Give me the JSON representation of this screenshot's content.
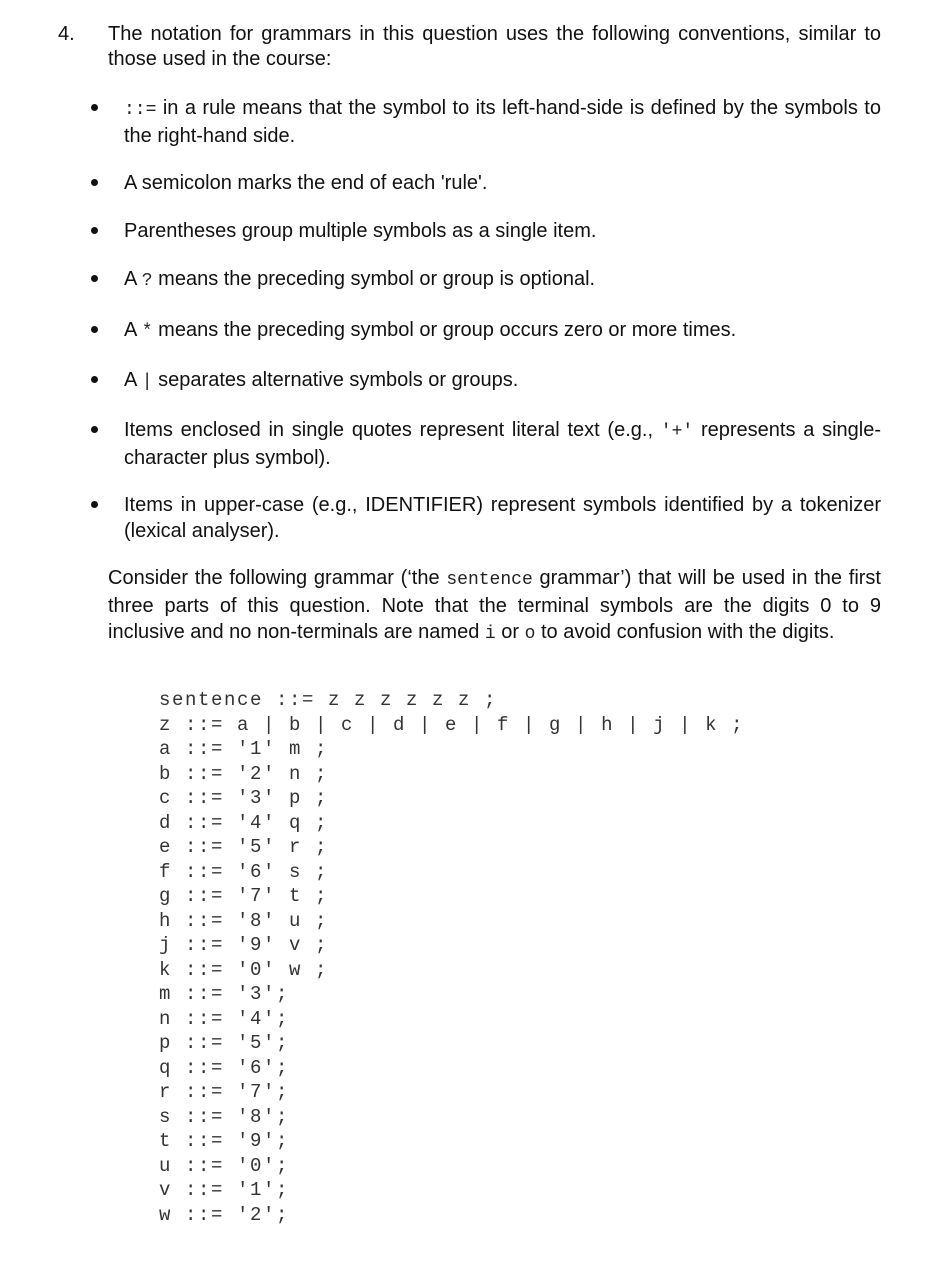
{
  "question": {
    "number": "4.",
    "intro": "The notation for grammars in this question uses the following conventions, similar to those used in the course:"
  },
  "conventions": [
    {
      "code": "::=",
      "prefix": "",
      "text": " in a rule means that the symbol to its left-hand-side is defined by the symbols to the right-hand side."
    },
    {
      "code": "",
      "prefix": "A semicolon marks the end of each 'rule'.",
      "text": ""
    },
    {
      "code": "",
      "prefix": "Parentheses group multiple symbols as a single item.",
      "text": ""
    },
    {
      "code": "?",
      "prefix": "A ",
      "text": " means the preceding symbol or group is optional."
    },
    {
      "code": "*",
      "prefix": "A ",
      "text": " means the preceding symbol or group occurs zero or more times."
    },
    {
      "code": "|",
      "prefix": "A ",
      "text": " separates alternative symbols or groups."
    },
    {
      "code": "'+'",
      "prefix": "Items enclosed in single quotes represent literal text (e.g., ",
      "text": " represents a single-character plus symbol)."
    },
    {
      "code": "",
      "prefix": "Items in upper-case (e.g., IDENTIFIER) represent symbols identified by a tokenizer (lexical analyser).",
      "text": ""
    }
  ],
  "consider": {
    "p1": "Consider the following grammar (‘the ",
    "code1": "sentence",
    "p2": " grammar’) that will be used in the first three parts of this question. Note that the terminal symbols are the digits 0 to 9 inclusive and no non-terminals are named ",
    "code2": "i",
    "p3": " or ",
    "code3": "o",
    "p4": " to avoid confusion with the digits."
  },
  "grammar_lines": [
    "sentence ::= z z z z z z ;",
    "z ::= a | b | c | d | e | f | g | h | j | k ;",
    "a ::= '1' m ;",
    "b ::= '2' n ;",
    "c ::= '3' p ;",
    "d ::= '4' q ;",
    "e ::= '5' r ;",
    "f ::= '6' s ;",
    "g ::= '7' t ;",
    "h ::= '8' u ;",
    "j ::= '9' v ;",
    "k ::= '0' w ;",
    "m ::= '3';",
    "n ::= '4';",
    "p ::= '5';",
    "q ::= '6';",
    "r ::= '7';",
    "s ::= '8';",
    "t ::= '9';",
    "u ::= '0';",
    "v ::= '1';",
    "w ::= '2';"
  ]
}
